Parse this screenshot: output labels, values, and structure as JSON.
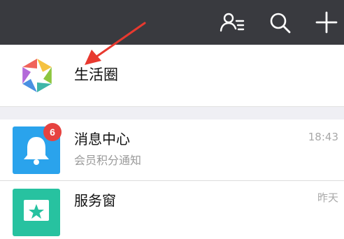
{
  "toolbar": {
    "icons": [
      "contacts-icon",
      "search-icon",
      "plus-icon"
    ],
    "background": "#393a3f"
  },
  "feature": {
    "label": "生活圈",
    "icon": "aperture-icon"
  },
  "chats": [
    {
      "title": "消息中心",
      "preview": "会员积分通知",
      "time": "18:43",
      "badge": "6",
      "icon": "bell-icon",
      "color": "#2aa3ec"
    },
    {
      "title": "服务窗",
      "preview": "",
      "time": "昨天",
      "icon": "star-icon",
      "color": "#27c2a0"
    }
  ],
  "colors": {
    "accent_red": "#e64340",
    "arrow": "#e8392f"
  }
}
